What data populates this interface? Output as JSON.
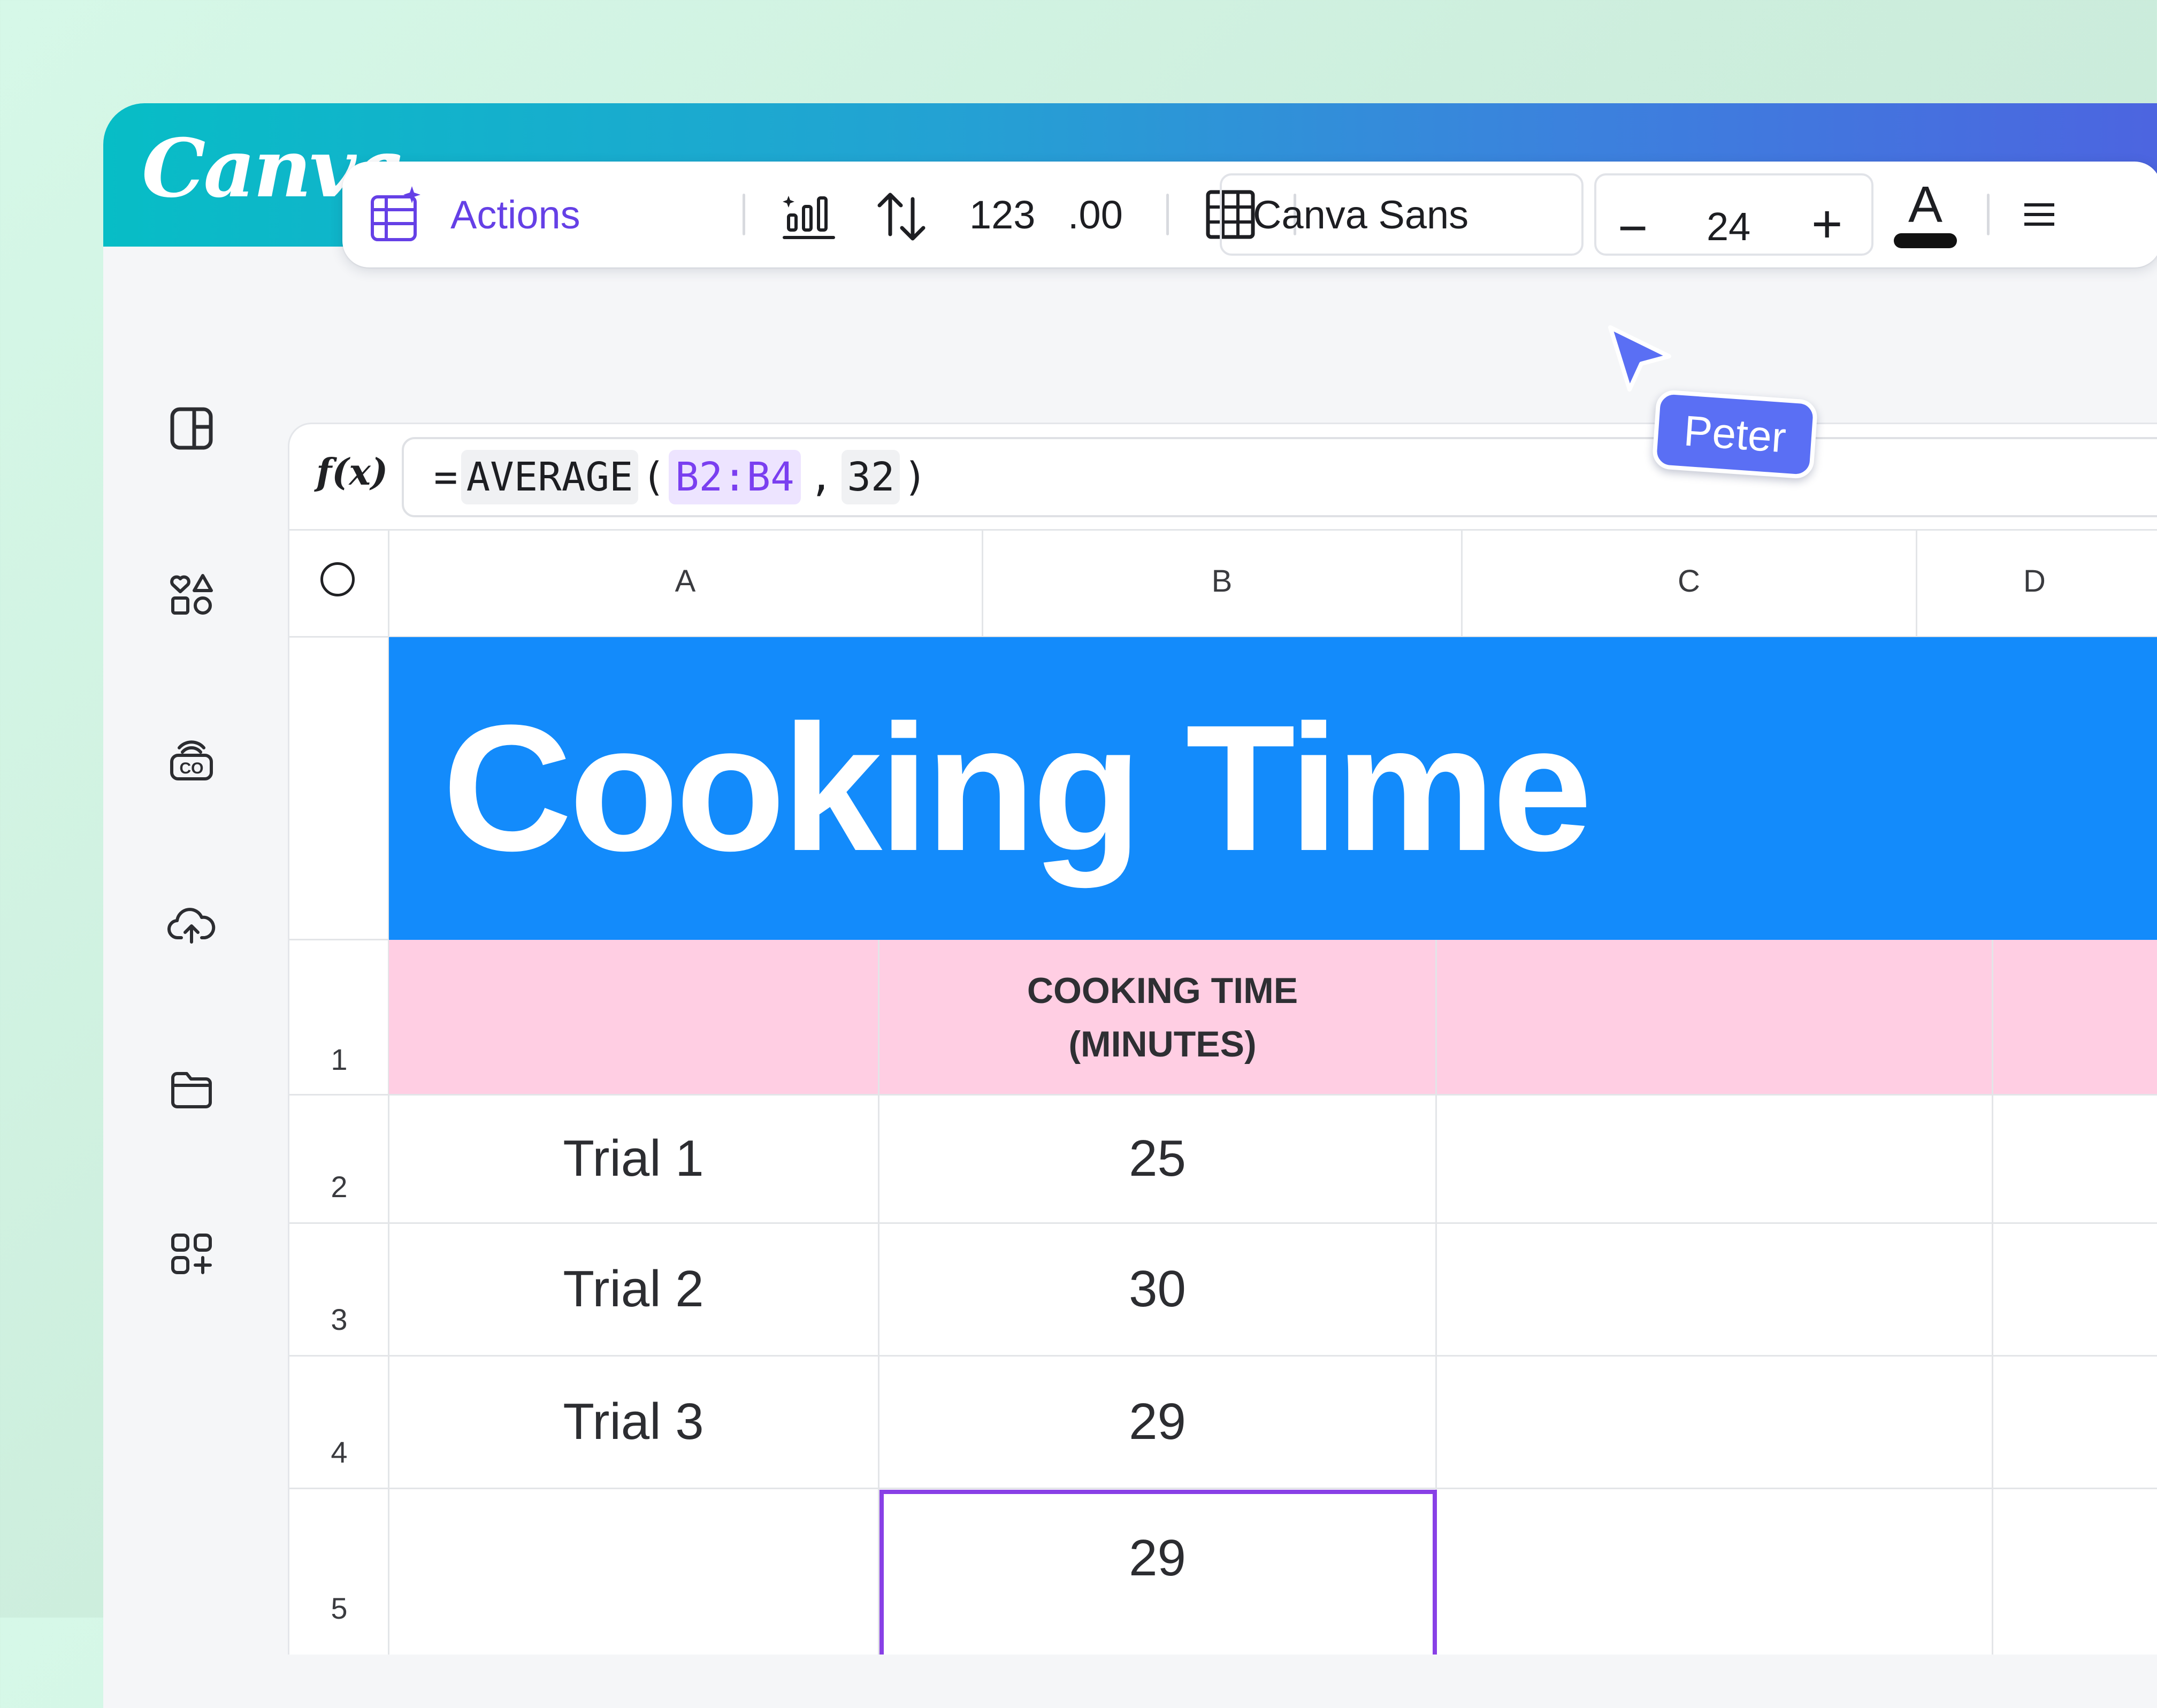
{
  "app": {
    "logo_text": "Canva",
    "brand_color": "#6540e6"
  },
  "sidebar": {
    "items": [
      {
        "icon": "layout-panel-icon"
      },
      {
        "icon": "elements-icon"
      },
      {
        "icon": "brand-icon"
      },
      {
        "icon": "upload-cloud-icon"
      },
      {
        "icon": "folder-icon"
      },
      {
        "icon": "apps-icon"
      }
    ]
  },
  "toolbar": {
    "actions_label": "Actions",
    "number_format_label": "123",
    "decimal_label": ".00",
    "font_name": "Canva Sans",
    "font_size": "24",
    "decrease_label": "−",
    "increase_label": "+",
    "text_color_label": "A"
  },
  "collaborator": {
    "name": "Peter",
    "color": "#5a6ff4"
  },
  "formula_bar": {
    "fx_label": "f(x)",
    "eq": "=",
    "function": "AVERAGE",
    "open_paren": "(",
    "range": "B2:B4",
    "comma": ",",
    "arg2": "32",
    "close_paren": ")"
  },
  "sheet": {
    "columns": [
      "A",
      "B",
      "C",
      "D"
    ],
    "title": "Cooking Time",
    "title_bg": "#138bfb",
    "header_bg": "#ffcee3",
    "header_line1": "COOKING TIME",
    "header_line2": "(MINUTES)",
    "row_numbers": [
      "1",
      "2",
      "3",
      "4",
      "5"
    ],
    "rows": [
      {
        "label": "Trial 1",
        "value": "25"
      },
      {
        "label": "Trial 2",
        "value": "30"
      },
      {
        "label": "Trial 3",
        "value": "29"
      },
      {
        "label": "",
        "value": "29"
      }
    ],
    "selection_color": "#8840e6"
  }
}
